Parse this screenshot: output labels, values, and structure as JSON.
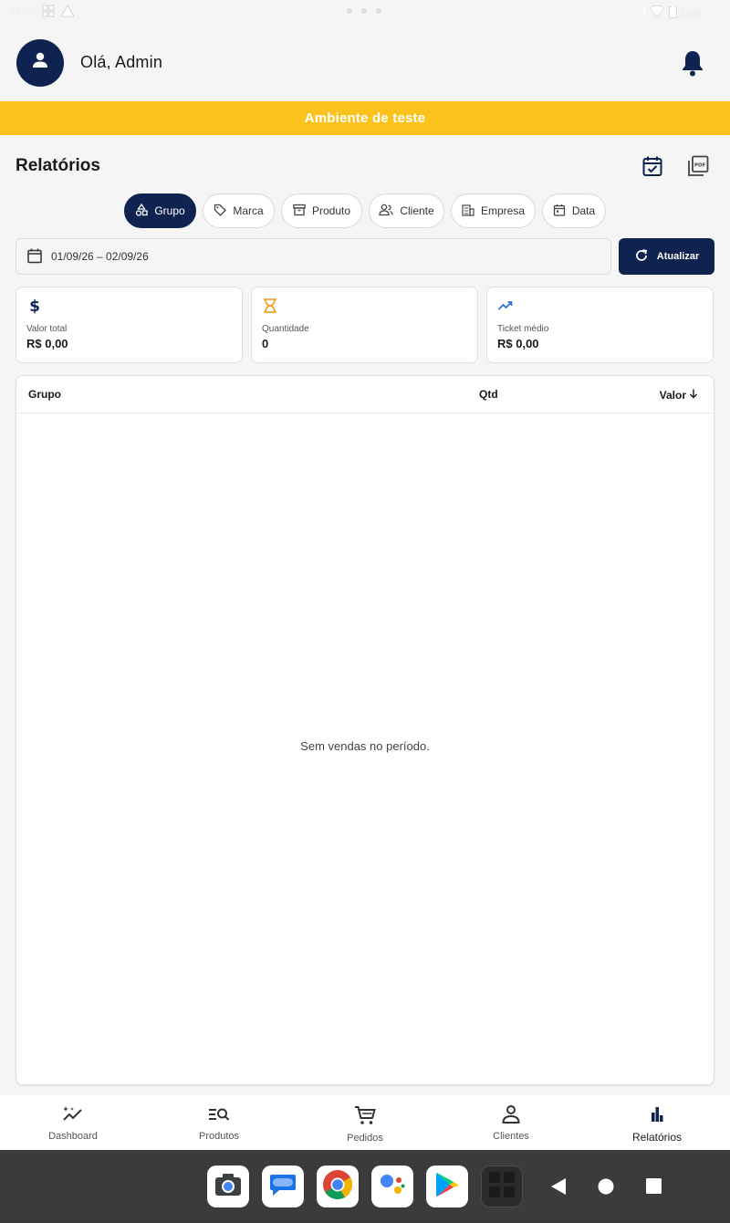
{
  "status": {
    "time": "14:02",
    "battery": "91%"
  },
  "header": {
    "greeting": "Olá, Admin"
  },
  "banner": {
    "text": "Ambiente de teste"
  },
  "page": {
    "title": "Relatórios"
  },
  "chips": [
    {
      "label": "Grupo",
      "icon": "shapes-icon",
      "active": true
    },
    {
      "label": "Marca",
      "icon": "tag-icon",
      "active": false
    },
    {
      "label": "Produto",
      "icon": "archive-box-icon",
      "active": false
    },
    {
      "label": "Cliente",
      "icon": "users-icon",
      "active": false
    },
    {
      "label": "Empresa",
      "icon": "building-icon",
      "active": false
    },
    {
      "label": "Data",
      "icon": "calendar-icon",
      "active": false
    }
  ],
  "filter": {
    "date_range": "01/09/26 – 02/09/26",
    "refresh_label": "Atualizar"
  },
  "summary": [
    {
      "label": "Valor total",
      "value": "R$ 0,00",
      "icon": "dollar-icon",
      "color": "#0f2350"
    },
    {
      "label": "Quantidade",
      "value": "0",
      "icon": "hourglass-icon",
      "color": "#f0a020"
    },
    {
      "label": "Ticket médio",
      "value": "R$ 0,00",
      "icon": "trending-up-icon",
      "color": "#2a6fd6"
    }
  ],
  "table": {
    "columns": [
      "Grupo",
      "Qtd",
      "Valor"
    ],
    "empty_message": "Sem vendas no período."
  },
  "nav": [
    {
      "label": "Dashboard",
      "icon": "sparkle-chart-icon",
      "active": false
    },
    {
      "label": "Produtos",
      "icon": "list-search-icon",
      "active": false
    },
    {
      "label": "Pedidos",
      "icon": "cart-icon",
      "active": false
    },
    {
      "label": "Clientes",
      "icon": "person-icon",
      "active": false
    },
    {
      "label": "Relatórios",
      "icon": "bar-chart-icon",
      "active": true
    }
  ],
  "colors": {
    "primary": "#0f2350",
    "banner": "#fbc21e",
    "background": "#f5f5f5"
  }
}
